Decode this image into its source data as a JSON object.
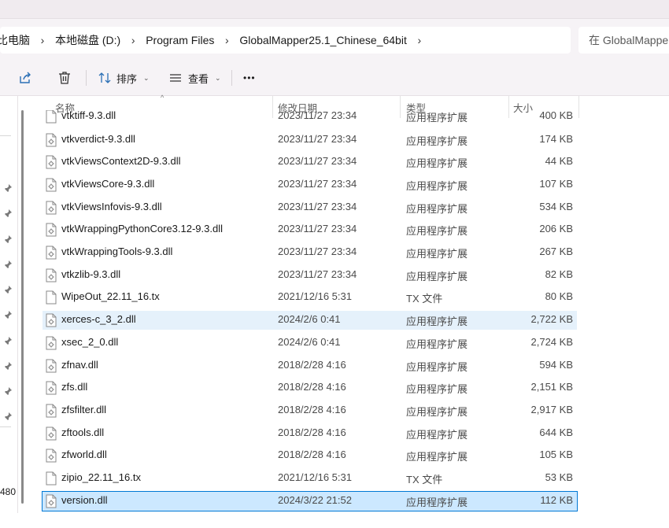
{
  "breadcrumb": {
    "items": [
      "此电脑",
      "本地磁盘 (D:)",
      "Program Files",
      "GlobalMapper25.1_Chinese_64bit"
    ],
    "first_partial": "比电脑"
  },
  "search": {
    "placeholder": "在 GlobalMapper"
  },
  "toolbar": {
    "share_icon": "share-icon",
    "delete_icon": "trash-icon",
    "sort_label": "排序",
    "view_label": "查看",
    "more_label": "•••"
  },
  "columns": {
    "name": "名称",
    "date": "修改日期",
    "type": "类型",
    "size": "大小"
  },
  "partial_row": {
    "name": "vtktiff-9.3.dll",
    "date": "2023/11/27 23:34",
    "type": "应用程序扩展",
    "size": "400 KB"
  },
  "files": [
    {
      "name": "vtkverdict-9.3.dll",
      "date": "2023/11/27 23:34",
      "type": "应用程序扩展",
      "size": "174 KB",
      "kind": "dll",
      "state": ""
    },
    {
      "name": "vtkViewsContext2D-9.3.dll",
      "date": "2023/11/27 23:34",
      "type": "应用程序扩展",
      "size": "44 KB",
      "kind": "dll",
      "state": ""
    },
    {
      "name": "vtkViewsCore-9.3.dll",
      "date": "2023/11/27 23:34",
      "type": "应用程序扩展",
      "size": "107 KB",
      "kind": "dll",
      "state": ""
    },
    {
      "name": "vtkViewsInfovis-9.3.dll",
      "date": "2023/11/27 23:34",
      "type": "应用程序扩展",
      "size": "534 KB",
      "kind": "dll",
      "state": ""
    },
    {
      "name": "vtkWrappingPythonCore3.12-9.3.dll",
      "date": "2023/11/27 23:34",
      "type": "应用程序扩展",
      "size": "206 KB",
      "kind": "dll",
      "state": ""
    },
    {
      "name": "vtkWrappingTools-9.3.dll",
      "date": "2023/11/27 23:34",
      "type": "应用程序扩展",
      "size": "267 KB",
      "kind": "dll",
      "state": ""
    },
    {
      "name": "vtkzlib-9.3.dll",
      "date": "2023/11/27 23:34",
      "type": "应用程序扩展",
      "size": "82 KB",
      "kind": "dll",
      "state": ""
    },
    {
      "name": "WipeOut_22.11_16.tx",
      "date": "2021/12/16 5:31",
      "type": "TX 文件",
      "size": "80 KB",
      "kind": "file",
      "state": ""
    },
    {
      "name": "xerces-c_3_2.dll",
      "date": "2024/2/6 0:41",
      "type": "应用程序扩展",
      "size": "2,722 KB",
      "kind": "dll",
      "state": "hover"
    },
    {
      "name": "xsec_2_0.dll",
      "date": "2024/2/6 0:41",
      "type": "应用程序扩展",
      "size": "2,724 KB",
      "kind": "dll",
      "state": ""
    },
    {
      "name": "zfnav.dll",
      "date": "2018/2/28 4:16",
      "type": "应用程序扩展",
      "size": "594 KB",
      "kind": "dll",
      "state": ""
    },
    {
      "name": "zfs.dll",
      "date": "2018/2/28 4:16",
      "type": "应用程序扩展",
      "size": "2,151 KB",
      "kind": "dll",
      "state": ""
    },
    {
      "name": "zfsfilter.dll",
      "date": "2018/2/28 4:16",
      "type": "应用程序扩展",
      "size": "2,917 KB",
      "kind": "dll",
      "state": ""
    },
    {
      "name": "zftools.dll",
      "date": "2018/2/28 4:16",
      "type": "应用程序扩展",
      "size": "644 KB",
      "kind": "dll",
      "state": ""
    },
    {
      "name": "zfworld.dll",
      "date": "2018/2/28 4:16",
      "type": "应用程序扩展",
      "size": "105 KB",
      "kind": "dll",
      "state": ""
    },
    {
      "name": "zipio_22.11_16.tx",
      "date": "2021/12/16 5:31",
      "type": "TX 文件",
      "size": "53 KB",
      "kind": "file",
      "state": ""
    },
    {
      "name": "version.dll",
      "date": "2024/3/22 21:52",
      "type": "应用程序扩展",
      "size": "112 KB",
      "kind": "dll",
      "state": "selected"
    }
  ],
  "sidebar": {
    "partial_count": "480"
  },
  "colors": {
    "accent": "#0078d4",
    "hover": "#e5f1fb",
    "selected": "#cce8ff"
  }
}
